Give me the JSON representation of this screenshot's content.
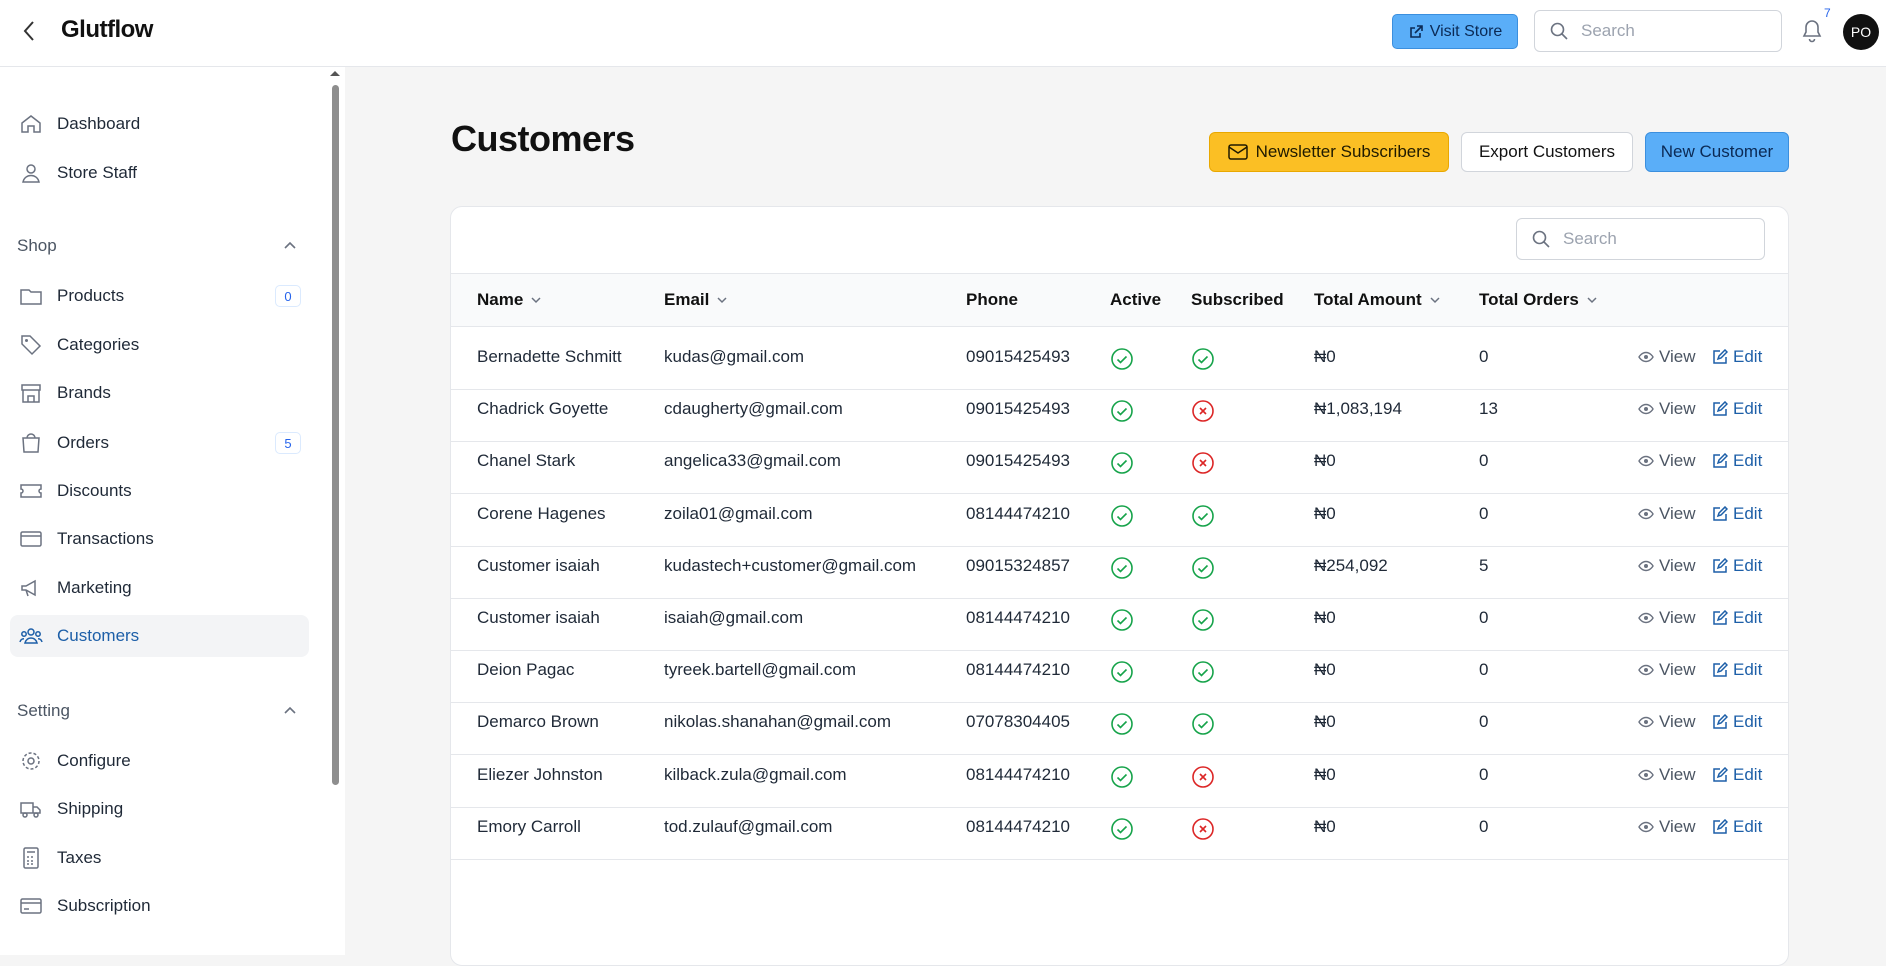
{
  "header": {
    "title": "Glutflow",
    "visit_store": "Visit Store",
    "search_placeholder": "Search",
    "notification_count": "7",
    "avatar_initials": "PO"
  },
  "sidebar": {
    "top_items": [
      {
        "label": "Dashboard",
        "icon": "home-icon"
      },
      {
        "label": "Store Staff",
        "icon": "user-icon"
      }
    ],
    "shop_section": "Shop",
    "shop_items": [
      {
        "label": "Products",
        "icon": "folder-icon",
        "badge": "0"
      },
      {
        "label": "Categories",
        "icon": "tag-icon"
      },
      {
        "label": "Brands",
        "icon": "store-icon"
      },
      {
        "label": "Orders",
        "icon": "shopping-bag-icon",
        "badge": "5"
      },
      {
        "label": "Discounts",
        "icon": "ticket-icon"
      },
      {
        "label": "Transactions",
        "icon": "credit-card-icon"
      },
      {
        "label": "Marketing",
        "icon": "megaphone-icon"
      },
      {
        "label": "Customers",
        "icon": "users-icon",
        "active": true
      }
    ],
    "setting_section": "Setting",
    "setting_items": [
      {
        "label": "Configure",
        "icon": "gear-icon"
      },
      {
        "label": "Shipping",
        "icon": "truck-icon"
      },
      {
        "label": "Taxes",
        "icon": "calculator-icon"
      },
      {
        "label": "Subscription",
        "icon": "credit-card-icon"
      }
    ]
  },
  "main": {
    "title": "Customers",
    "newsletter_button": "Newsletter Subscribers",
    "export_button": "Export Customers",
    "new_button": "New Customer",
    "table_search_placeholder": "Search",
    "columns": [
      "Name",
      "Email",
      "Phone",
      "Active",
      "Subscribed",
      "Total Amount",
      "Total Orders"
    ],
    "view_label": "View",
    "edit_label": "Edit",
    "rows": [
      {
        "name": "Bernadette Schmitt",
        "email": "kudas@gmail.com",
        "phone": "09015425493",
        "active": true,
        "subscribed": true,
        "amount": "₦0",
        "orders": "0"
      },
      {
        "name": "Chadrick Goyette",
        "email": "cdaugherty@gmail.com",
        "phone": "09015425493",
        "active": true,
        "subscribed": false,
        "amount": "₦1,083,194",
        "orders": "13"
      },
      {
        "name": "Chanel Stark",
        "email": "angelica33@gmail.com",
        "phone": "09015425493",
        "active": true,
        "subscribed": false,
        "amount": "₦0",
        "orders": "0"
      },
      {
        "name": "Corene Hagenes",
        "email": "zoila01@gmail.com",
        "phone": "08144474210",
        "active": true,
        "subscribed": true,
        "amount": "₦0",
        "orders": "0"
      },
      {
        "name": "Customer isaiah",
        "email": "kudastech+customer@gmail.com",
        "phone": "09015324857",
        "active": true,
        "subscribed": true,
        "amount": "₦254,092",
        "orders": "5"
      },
      {
        "name": "Customer isaiah",
        "email": "isaiah@gmail.com",
        "phone": "08144474210",
        "active": true,
        "subscribed": true,
        "amount": "₦0",
        "orders": "0"
      },
      {
        "name": "Deion Pagac",
        "email": "tyreek.bartell@gmail.com",
        "phone": "08144474210",
        "active": true,
        "subscribed": true,
        "amount": "₦0",
        "orders": "0"
      },
      {
        "name": "Demarco Brown",
        "email": "nikolas.shanahan@gmail.com",
        "phone": "07078304405",
        "active": true,
        "subscribed": true,
        "amount": "₦0",
        "orders": "0"
      },
      {
        "name": "Eliezer Johnston",
        "email": "kilback.zula@gmail.com",
        "phone": "08144474210",
        "active": true,
        "subscribed": false,
        "amount": "₦0",
        "orders": "0"
      },
      {
        "name": "Emory Carroll",
        "email": "tod.zulauf@gmail.com",
        "phone": "08144474210",
        "active": true,
        "subscribed": false,
        "amount": "₦0",
        "orders": "0"
      }
    ]
  },
  "colors": {
    "primary_blue": "#5aaef8",
    "newsletter_yellow": "#fbbf24",
    "check_green": "#16a34a",
    "cross_red": "#dc2626",
    "link_blue": "#1d5fa8"
  }
}
